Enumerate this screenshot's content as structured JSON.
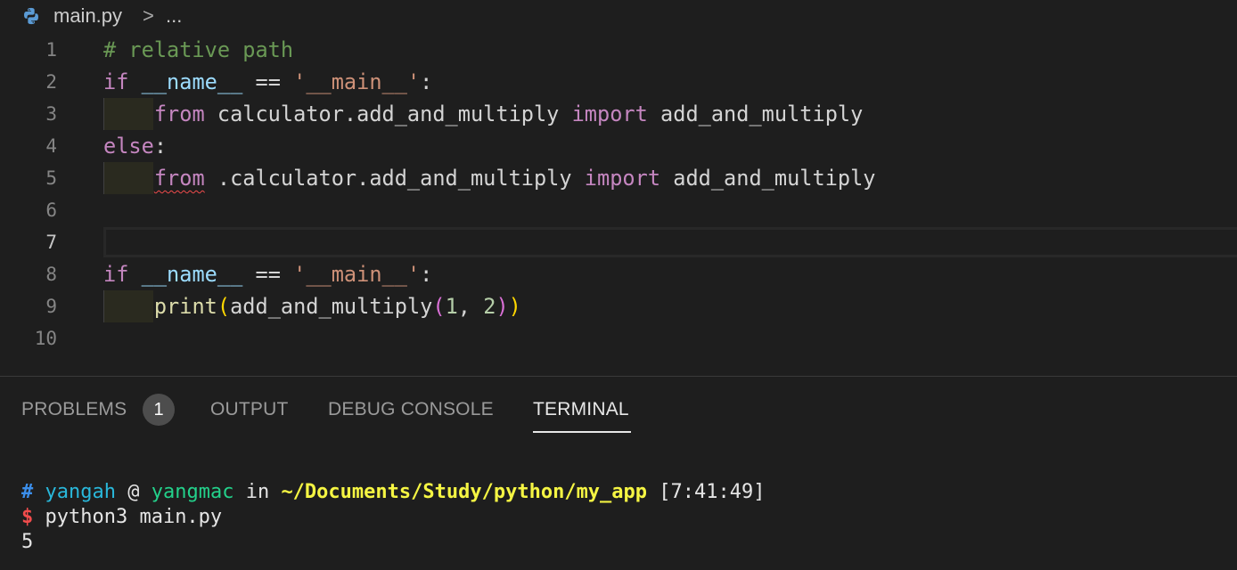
{
  "breadcrumb": {
    "file_name": "main.py",
    "separator": ">",
    "more": "..."
  },
  "editor": {
    "lines": [
      {
        "n": "1",
        "tokens": [
          {
            "t": "# relative path",
            "c": "cm"
          }
        ]
      },
      {
        "n": "2",
        "tokens": [
          {
            "t": "if",
            "c": "kw"
          },
          {
            "t": " ",
            "c": ""
          },
          {
            "t": "__name__",
            "c": "var"
          },
          {
            "t": " == ",
            "c": ""
          },
          {
            "t": "'__main__'",
            "c": "str"
          },
          {
            "t": ":",
            "c": ""
          }
        ]
      },
      {
        "n": "3",
        "indent": true,
        "tokens": [
          {
            "t": "    ",
            "c": ""
          },
          {
            "t": "from",
            "c": "kw"
          },
          {
            "t": " calculator.add_and_multiply ",
            "c": ""
          },
          {
            "t": "import",
            "c": "kw"
          },
          {
            "t": " add_and_multiply",
            "c": ""
          }
        ]
      },
      {
        "n": "4",
        "tokens": [
          {
            "t": "else",
            "c": "kw"
          },
          {
            "t": ":",
            "c": ""
          }
        ]
      },
      {
        "n": "5",
        "indent": true,
        "tokens": [
          {
            "t": "    ",
            "c": ""
          },
          {
            "t": "from",
            "c": "kw squiggle"
          },
          {
            "t": " .calculator.add_and_multiply ",
            "c": ""
          },
          {
            "t": "import",
            "c": "kw"
          },
          {
            "t": " add_and_multiply",
            "c": ""
          }
        ]
      },
      {
        "n": "6",
        "tokens": []
      },
      {
        "n": "7",
        "current": true,
        "tokens": []
      },
      {
        "n": "8",
        "tokens": [
          {
            "t": "if",
            "c": "kw"
          },
          {
            "t": " ",
            "c": ""
          },
          {
            "t": "__name__",
            "c": "var"
          },
          {
            "t": " == ",
            "c": ""
          },
          {
            "t": "'__main__'",
            "c": "str"
          },
          {
            "t": ":",
            "c": ""
          }
        ]
      },
      {
        "n": "9",
        "indent": true,
        "tokens": [
          {
            "t": "    ",
            "c": ""
          },
          {
            "t": "print",
            "c": "fn"
          },
          {
            "t": "(",
            "c": "br1"
          },
          {
            "t": "add_and_multiply",
            "c": ""
          },
          {
            "t": "(",
            "c": "br2"
          },
          {
            "t": "1",
            "c": "num"
          },
          {
            "t": ", ",
            "c": ""
          },
          {
            "t": "2",
            "c": "num"
          },
          {
            "t": ")",
            "c": "br2"
          },
          {
            "t": ")",
            "c": "br1"
          }
        ]
      },
      {
        "n": "10",
        "tokens": []
      }
    ]
  },
  "panel": {
    "tabs": [
      {
        "label": "PROBLEMS",
        "active": false
      },
      {
        "label": "OUTPUT",
        "active": false
      },
      {
        "label": "DEBUG CONSOLE",
        "active": false
      },
      {
        "label": "TERMINAL",
        "active": true
      }
    ],
    "problems_count": "1"
  },
  "terminal": {
    "prompt_hash": "#",
    "user": "yangah",
    "at": " @ ",
    "host": "yangmac",
    "in": " in ",
    "path": "~/Documents/Study/python/my_app",
    "time": " [7:41:49]",
    "dollar": "$",
    "command": " python3 main.py",
    "output": "5"
  },
  "colors": {
    "background": "#1e1e1e",
    "keyword": "#c586c0",
    "comment": "#6a9955",
    "string": "#ce9178",
    "variable": "#9cdcfe",
    "function": "#dcdcaa",
    "number": "#b5cea8",
    "error": "#f14c4c"
  },
  "icons": {
    "file_icon": "python-icon"
  }
}
